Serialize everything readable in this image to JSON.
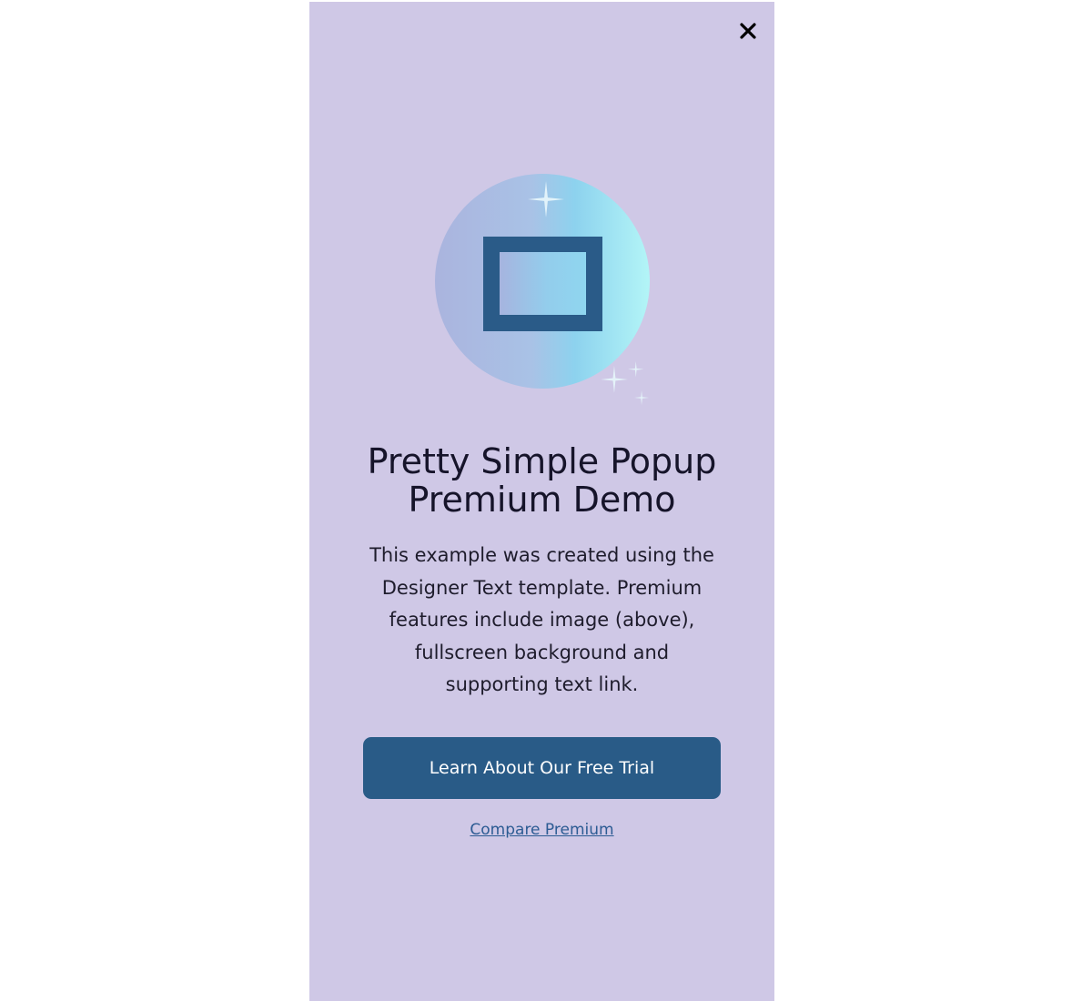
{
  "popup": {
    "background_color": "#cfc8e6",
    "close_icon": "close-icon",
    "hero_image_icon": "image-frame-icon",
    "title": "Pretty Simple Popup Premium Demo",
    "description": "This example was created using the Designer Text template. Premium features include image (above), fullscreen background and supporting text link.",
    "cta_label": "Learn About Our Free Trial",
    "cta_color": "#295b87",
    "link_label": "Compare Premium",
    "link_color": "#2c5b93"
  }
}
